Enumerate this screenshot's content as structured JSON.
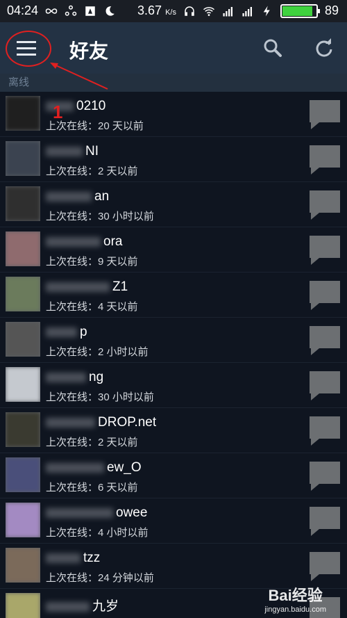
{
  "statusbar": {
    "time": "04:24",
    "speed": "3.67",
    "speed_unit": "K/s",
    "battery": "89",
    "battery_level": 0.89
  },
  "appbar": {
    "title": "好友",
    "icons": [
      "menu-icon",
      "search-icon",
      "refresh-icon"
    ]
  },
  "section": {
    "label": "离线"
  },
  "friends": [
    {
      "name": "0210",
      "status": "上次在线：20 天以前",
      "avatar_color": "#1f1f1f"
    },
    {
      "name": "NI",
      "status": "上次在线：2 天以前",
      "avatar_color": "#3b4350"
    },
    {
      "name": "an",
      "status": "上次在线：30 小时以前",
      "avatar_color": "#2f2f2f"
    },
    {
      "name": "ora",
      "status": "上次在线：9 天以前",
      "avatar_color": "#8f6b6e"
    },
    {
      "name": "Z1",
      "status": "上次在线：4 天以前",
      "avatar_color": "#6b7b5c"
    },
    {
      "name": "p",
      "status": "上次在线：2 小时以前",
      "avatar_color": "#555555"
    },
    {
      "name": "ng",
      "status": "上次在线：30 小时以前",
      "avatar_color": "#c5c9cf"
    },
    {
      "name": "DROP.net",
      "status": "上次在线：2 天以前",
      "avatar_color": "#3a3a30"
    },
    {
      "name": "ew_O",
      "status": "上次在线：6 天以前",
      "avatar_color": "#4a4f7a"
    },
    {
      "name": "owee",
      "status": "上次在线：4 小时以前",
      "avatar_color": "#a38ac2"
    },
    {
      "name": "tzz",
      "status": "上次在线：24 分钟以前",
      "avatar_color": "#7b6a5a"
    },
    {
      "name": "九岁",
      "status": "",
      "avatar_color": "#a9a76a"
    }
  ],
  "annotation": {
    "number": "1"
  },
  "watermark": {
    "line1": "Bai经验",
    "line2": "jingyan.baidu.com"
  },
  "colors": {
    "appbar": "#233244",
    "background": "#0f1520",
    "accent_annotation": "#e02020",
    "chat_icon": "#6c6f72"
  }
}
